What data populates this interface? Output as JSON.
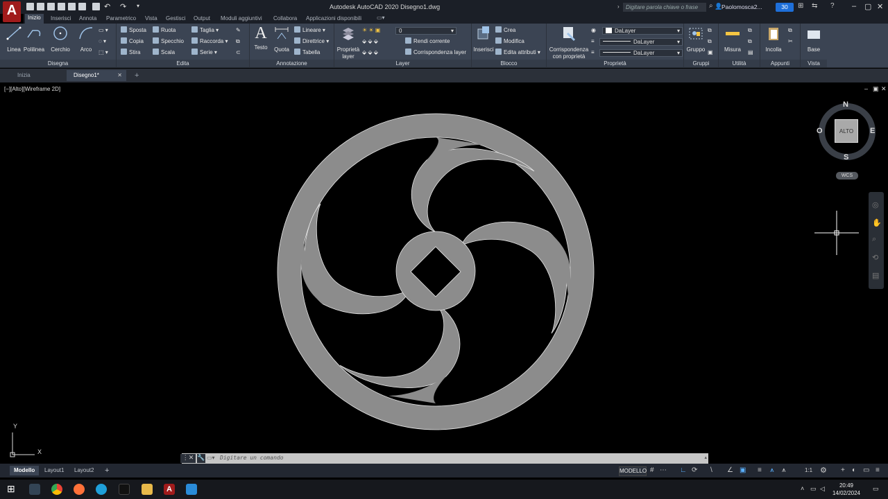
{
  "window": {
    "title": "Autodesk AutoCAD 2020   Disegno1.dwg",
    "app_logo": "A",
    "search_placeholder": "Digitare parola chiave o frase",
    "user": "Paolomosca2...",
    "badge": "30"
  },
  "ribbon_tabs": [
    "Inizio",
    "Inserisci",
    "Annota",
    "Parametrico",
    "Vista",
    "Gestisci",
    "Output",
    "Moduli aggiuntivi",
    "Collabora",
    "Applicazioni disponibili"
  ],
  "ribbon": {
    "disegna": {
      "title": "Disegna",
      "tools": [
        "Linea",
        "Polilinea",
        "Cerchio",
        "Arco"
      ]
    },
    "edita": {
      "title": "Edita",
      "tools": [
        "Sposta",
        "Ruota",
        "Taglia",
        "Copia",
        "Specchio",
        "Raccorda",
        "Stira",
        "Scala",
        "Serie"
      ]
    },
    "annotazione": {
      "title": "Annotazione",
      "tools": [
        "Testo",
        "Quota",
        "Lineare",
        "Direttrice",
        "Tabella"
      ]
    },
    "layer": {
      "title": "Layer",
      "big": "Proprietà layer",
      "current": "0",
      "tools": [
        "Rendi corrente",
        "Corrispondenza layer"
      ]
    },
    "blocco": {
      "title": "Blocco",
      "big": "Inserisci",
      "tools": [
        "Crea",
        "Modifica",
        "Edita attributi"
      ]
    },
    "proprieta": {
      "title": "Proprietà",
      "big": "Corrispondenza con proprietà",
      "color": "DaLayer",
      "linetype": "DaLayer",
      "lineweight": "DaLayer"
    },
    "gruppi": {
      "title": "Gruppi",
      "big": "Gruppo"
    },
    "utilita": {
      "title": "Utilità",
      "big": "Misura"
    },
    "appunti": {
      "title": "Appunti",
      "big": "Incolla"
    },
    "vista": {
      "title": "Vista",
      "big": "Base"
    }
  },
  "file_tabs": [
    "Inizia",
    "Disegno1*"
  ],
  "viewport": {
    "label": "[−][Alto][Wireframe 2D]",
    "viewcube": {
      "top": "ALTO",
      "north": "N",
      "south": "S",
      "east": "E",
      "west": "O",
      "wcs": "WCS"
    },
    "ucs": {
      "x": "X",
      "y": "Y"
    }
  },
  "command": {
    "placeholder": "Digitare un comando"
  },
  "layout_tabs": [
    "Modello",
    "Layout1",
    "Layout2"
  ],
  "status": {
    "space": "MODELLO",
    "scale": "1:1"
  },
  "clock": {
    "time": "20:49",
    "date": "14/02/2024"
  },
  "colors": {
    "ribbon_bg": "#3b4453",
    "drawing_fill": "#8c8c8c",
    "accent": "#1e6fd9"
  }
}
